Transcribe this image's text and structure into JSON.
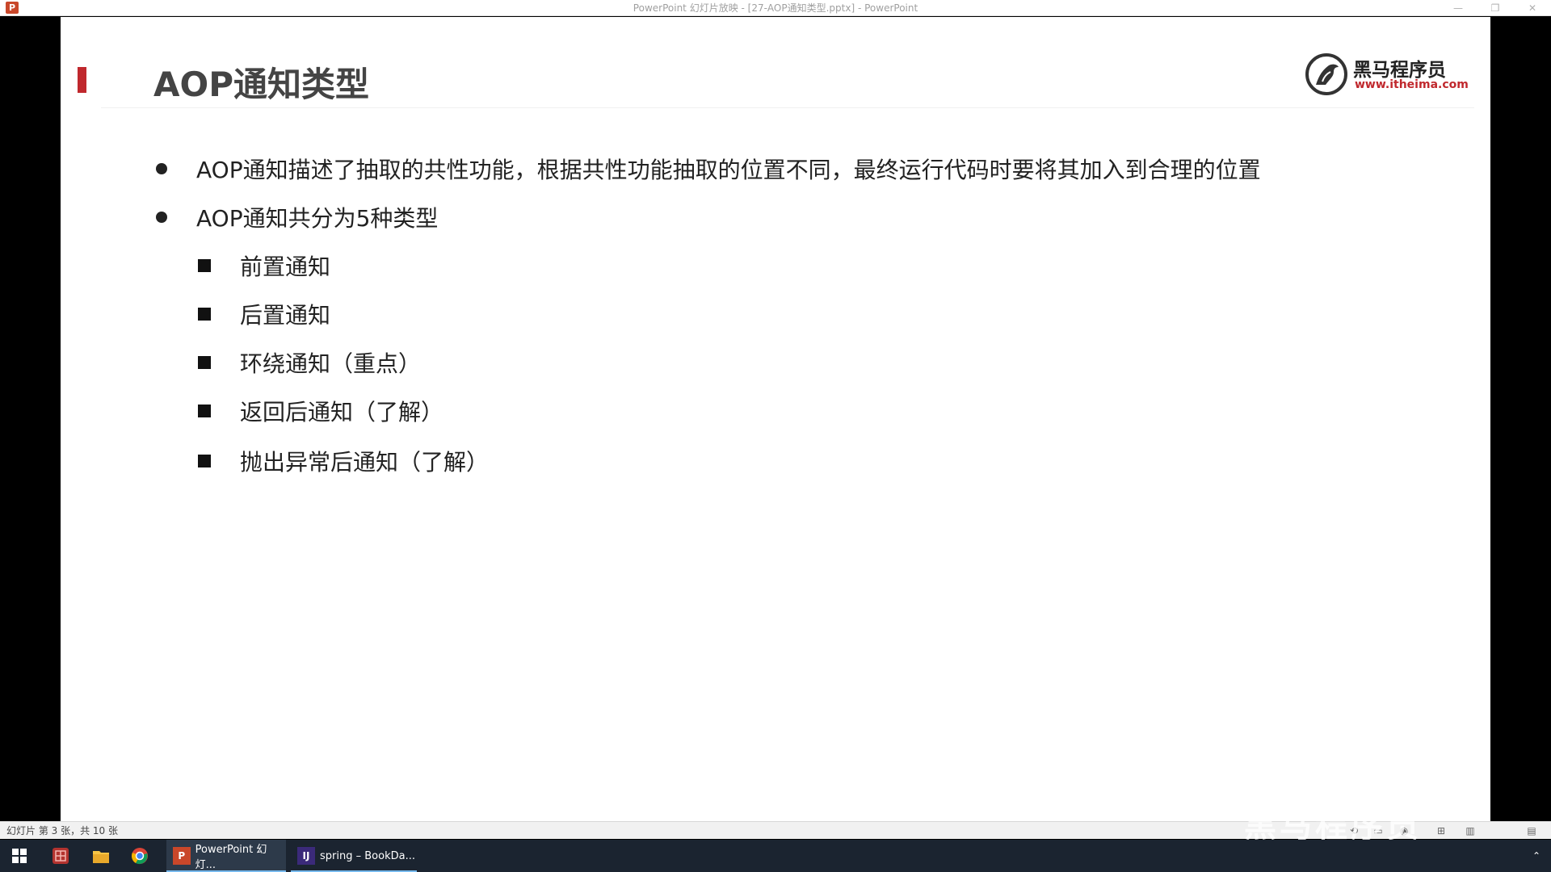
{
  "window": {
    "title": "PowerPoint 幻灯片放映 - [27-AOP通知类型.pptx] - PowerPoint",
    "app_icon_label": "P",
    "minimize_glyph": "—",
    "restore_glyph": "❐",
    "close_glyph": "✕"
  },
  "slide": {
    "title": "AOP通知类型",
    "logo": {
      "name": "黑马程序员",
      "url": "www.itheima.com"
    },
    "bullets": [
      {
        "level": 1,
        "text": "AOP通知描述了抽取的共性功能，根据共性功能抽取的位置不同，最终运行代码时要将其加入到合理的位置"
      },
      {
        "level": 1,
        "text": "AOP通知共分为5种类型"
      },
      {
        "level": 2,
        "text": "前置通知"
      },
      {
        "level": 2,
        "text": "后置通知"
      },
      {
        "level": 2,
        "text": "环绕通知（重点）"
      },
      {
        "level": 2,
        "text": "返回后通知（了解）"
      },
      {
        "level": 2,
        "text": "抛出异常后通知（了解）"
      }
    ],
    "accent_color": "#c0282d"
  },
  "statusbar": {
    "slide_info": "幻灯片 第 3 张，共 10 张",
    "watermark": "黑马程序员"
  },
  "taskbar": {
    "apps": [
      {
        "label": "PowerPoint 幻灯...",
        "icon": "powerpoint-icon"
      },
      {
        "label": "spring – BookDa...",
        "icon": "intellij-icon"
      }
    ]
  }
}
